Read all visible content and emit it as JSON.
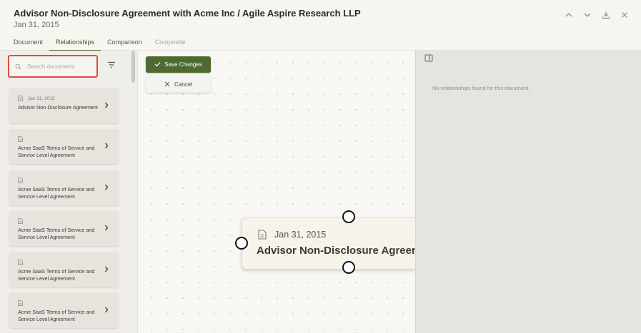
{
  "header": {
    "title": "Advisor Non-Disclosure Agreement with Acme Inc / Agile Aspire Research LLP",
    "date": "Jan 31, 2015"
  },
  "tabs": [
    {
      "label": "Document"
    },
    {
      "label": "Relationships"
    },
    {
      "label": "Comparison"
    },
    {
      "label": "Composite"
    }
  ],
  "search": {
    "placeholder": "Search documents",
    "value": ""
  },
  "documents": [
    {
      "date": "Jan 31, 2015",
      "name": "Advisor Non-Disclosure Agreement"
    },
    {
      "date": "",
      "name": "Acme SaaS Terms of Service and Service Level Agreement"
    },
    {
      "date": "",
      "name": "Acme SaaS Terms of Service and Service Level Agreement"
    },
    {
      "date": "",
      "name": "Acme SaaS Terms of Service and Service Level Agreement"
    },
    {
      "date": "",
      "name": "Acme SaaS Terms of Service and Service Level Agreement"
    },
    {
      "date": "",
      "name": "Acme SaaS Terms of Service and Service Level Agreement"
    }
  ],
  "actions": {
    "save_label": "Save Changes",
    "cancel_label": "Cancel"
  },
  "node": {
    "date": "Jan 31, 2015",
    "title": "Advisor Non-Disclosure Agreement"
  },
  "right_panel": {
    "empty_message": "No relationships found for this document."
  },
  "colors": {
    "accent": "#4f6a30",
    "highlight_border": "#e04a3c"
  }
}
